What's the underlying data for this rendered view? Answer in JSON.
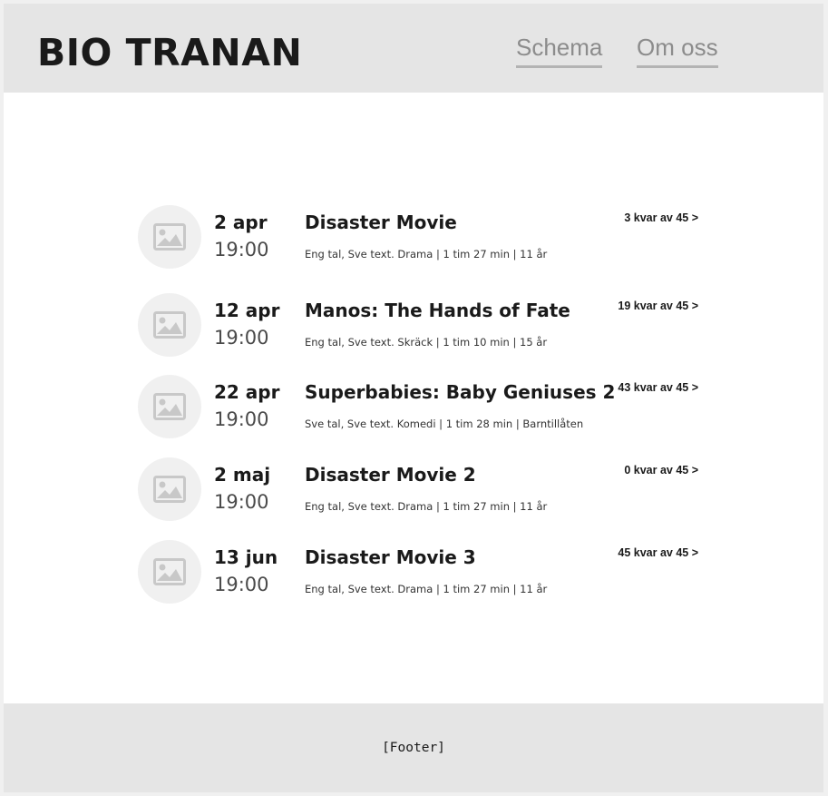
{
  "header": {
    "logo": "BIO TRANAN",
    "nav": [
      {
        "label": "Schema"
      },
      {
        "label": "Om oss"
      }
    ]
  },
  "screenings": [
    {
      "date": "2 apr",
      "time": "19:00",
      "title": "Disaster Movie",
      "meta": "Eng tal, Sve text. Drama | 1 tim 27 min | 11 år",
      "seats": "3 kvar av 45 >",
      "icon": "image-placeholder-icon"
    },
    {
      "date": "12 apr",
      "time": "19:00",
      "title": "Manos: The Hands of Fate",
      "meta": "Eng tal, Sve text. Skräck | 1 tim 10 min | 15 år",
      "seats": "19 kvar av 45 >",
      "icon": "image-placeholder-icon"
    },
    {
      "date": "22 apr",
      "time": "19:00",
      "title": "Superbabies: Baby Geniuses 2",
      "meta": "Sve tal, Sve text. Komedi | 1 tim 28 min | Barntillåten",
      "seats": "43 kvar av 45 >",
      "icon": "image-placeholder-icon"
    },
    {
      "date": "2 maj",
      "time": "19:00",
      "title": "Disaster Movie 2",
      "meta": "Eng tal, Sve text. Drama | 1 tim 27 min | 11 år",
      "seats": "0 kvar av 45 >",
      "icon": "image-placeholder-icon"
    },
    {
      "date": "13 jun",
      "time": "19:00",
      "title": "Disaster Movie 3",
      "meta": "Eng tal, Sve text. Drama | 1 tim 27 min | 11 år",
      "seats": "45 kvar av 45 >",
      "icon": "image-placeholder-icon"
    }
  ],
  "footer": {
    "text": "[Footer]"
  },
  "colors": {
    "header_bg": "#e5e5e5",
    "nav_text": "#8c8c8c",
    "nav_underline": "#b3b3b3",
    "thumb_bg": "#f0f0f0",
    "icon": "#c8c8c8"
  }
}
